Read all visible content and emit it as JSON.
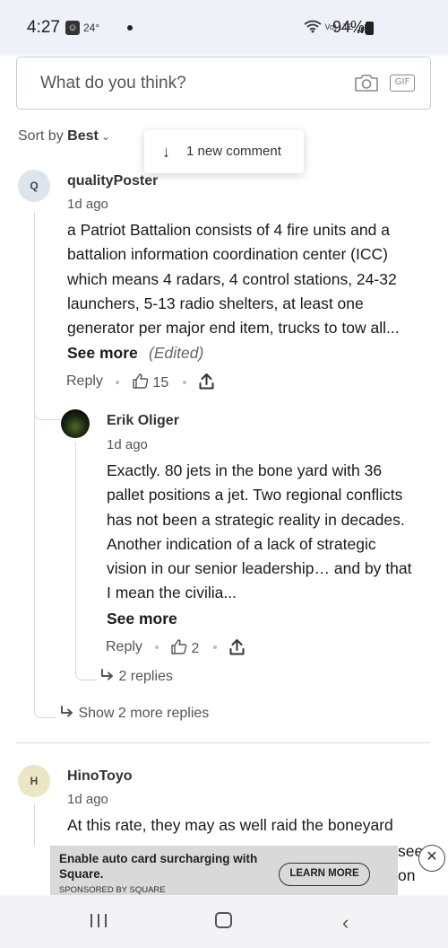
{
  "status_bar": {
    "time": "4:27",
    "temperature": "24°",
    "network": "Vo) LTE",
    "battery": "94%"
  },
  "composer": {
    "placeholder": "What do you think?",
    "gif_label": "GIF"
  },
  "sort": {
    "prefix": "Sort by",
    "value": "Best"
  },
  "new_comment_toast": {
    "label": "1 new comment"
  },
  "comments": [
    {
      "avatar_initial": "Q",
      "author": "qualityPoster",
      "ago": "1d ago",
      "lines": [
        "a Patriot Battalion consists of 4 fire units and a",
        "battalion information coordination center (ICC)",
        "which means 4 radars, 4 control stations, 24-32",
        "launchers, 5-13 radio shelters, at least one",
        "generator per major end item, trucks to tow all..."
      ],
      "see_more": "See more",
      "edited": "(Edited)",
      "reply_label": "Reply",
      "likes": "15",
      "reply": {
        "author": "Erik Oliger",
        "ago": "1d ago",
        "lines": [
          "Exactly. 80 jets in the bone yard with 36",
          "pallet positions a jet. Two regional conflicts",
          "has not been a strategic reality in decades.",
          "Another indication of a lack of strategic",
          "vision in our senior leadership… and by that",
          "I mean the civilia..."
        ],
        "see_more": "See more",
        "reply_label": "Reply",
        "likes": "2",
        "replies_link": "2 replies"
      },
      "more_replies_link": "Show 2 more replies"
    },
    {
      "avatar_initial": "H",
      "author": "HinoToyo",
      "ago": "1d ago",
      "first_line": "At this rate, they may as well raid the boneyard",
      "partial_behind_ad": [
        "see",
        "on"
      ]
    }
  ],
  "ad": {
    "title": "Enable auto card surcharging with Square.",
    "sponsor": "SPONSORED BY SQUARE",
    "cta": "LEARN MORE"
  }
}
